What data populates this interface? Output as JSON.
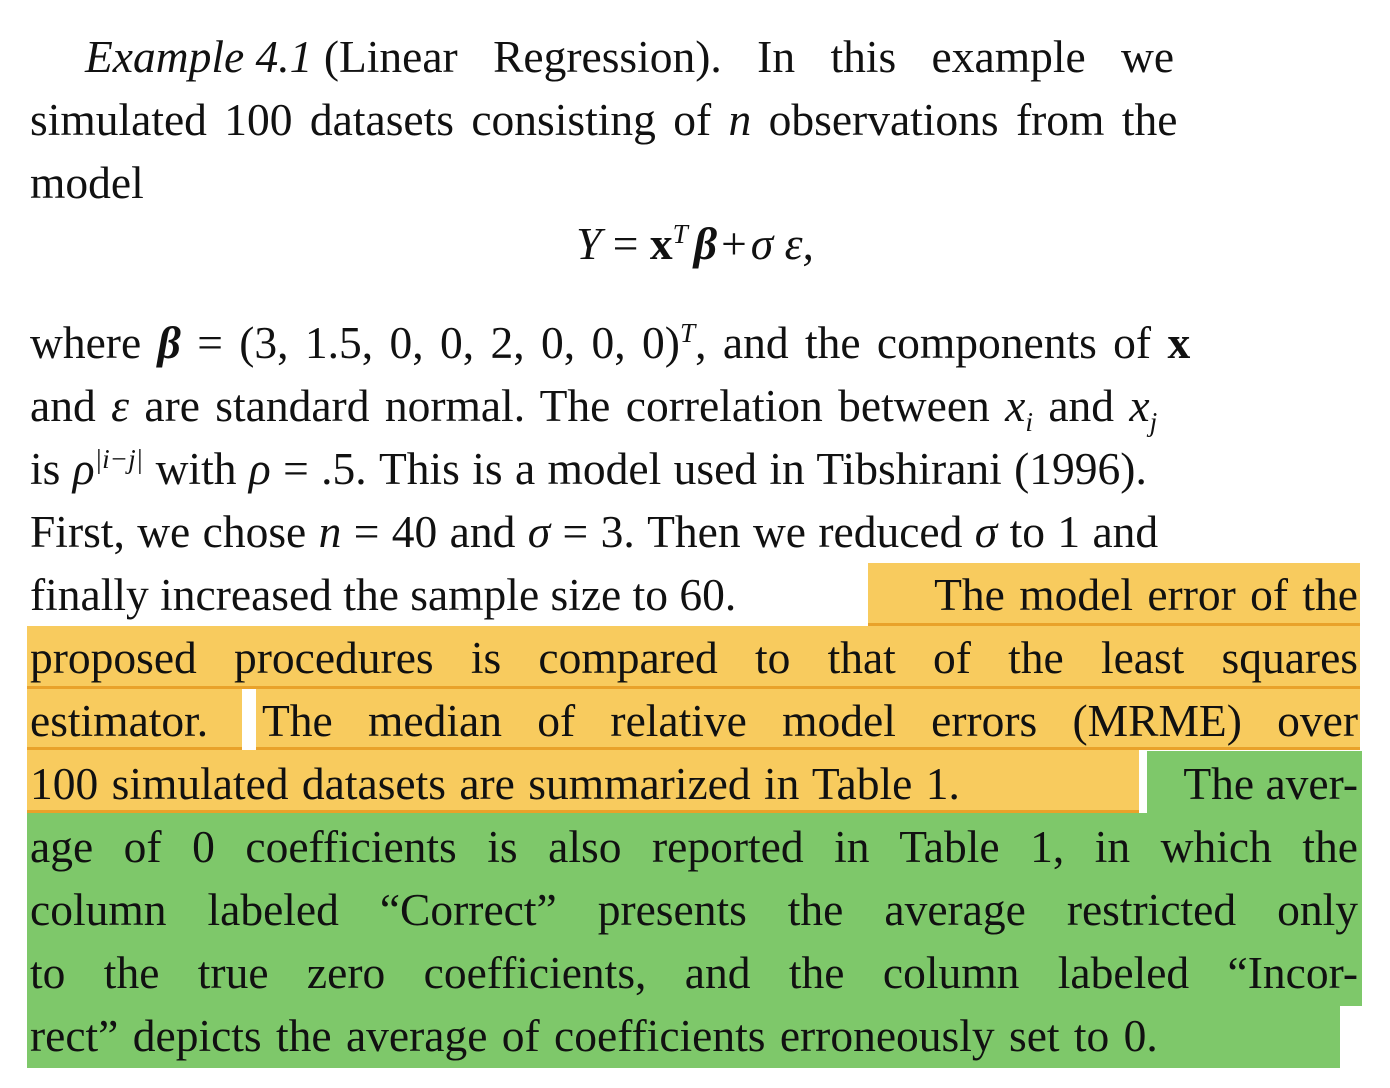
{
  "paragraph": {
    "line1": {
      "example_label": "Example 4.1",
      "rest": "(Linear Regression).  In this example we"
    },
    "line2": {
      "a": "simulated 100 datasets consisting of",
      "n": "n",
      "b": "observations from the"
    },
    "line3": "model",
    "equation": {
      "Y": "Y",
      "eq": "=",
      "x": "x",
      "T": "T",
      "beta": "β",
      "plus": "+",
      "sigma": "σ",
      "eps": "ε,"
    },
    "line5": {
      "a": "where",
      "beta": "β",
      "b": "= (3, 1.5, 0, 0, 2, 0, 0, 0)",
      "T": "T",
      "c": ", and the components of",
      "x": "x"
    },
    "line6": {
      "a": "and",
      "eps": "ε",
      "b": "are standard normal. The correlation between",
      "x1": "x",
      "i": "i",
      "c": "and",
      "x2": "x",
      "j": "j"
    },
    "line7": {
      "a": "is",
      "rho": "ρ",
      "exp": "|i−j|",
      "b": "with",
      "rho2": "ρ",
      "c": "= .5. This is a model used in Tibshirani (1996)."
    },
    "line8": {
      "a": "First, we chose",
      "n": "n",
      "b": "= 40 and",
      "sigma": "σ",
      "c": "= 3. Then we reduced",
      "sigma2": "σ",
      "d": "to 1 and"
    },
    "line9": {
      "plain": "finally increased the sample size to 60.",
      "highlight": "The model error of the"
    },
    "line10": "proposed procedures is compared to that of the least squares",
    "line11": {
      "a": "estimator.",
      "b": "The median of relative model errors (MRME) over"
    },
    "line12": {
      "a": "100 simulated datasets are summarized in Table 1.",
      "b": "The aver-"
    },
    "line13": "age of 0 coefficients is also reported in Table 1, in which the",
    "line14": "column labeled “Correct” presents the average restricted only",
    "line15": "to the true zero coefficients, and the column labeled “Incor-",
    "line16": "rect” depicts the average of coefficients erroneously set to 0."
  },
  "highlight_colors": {
    "yellow": "#f8cb5e",
    "yellow_underline": "#e9a22a",
    "green": "#7ec86a"
  }
}
